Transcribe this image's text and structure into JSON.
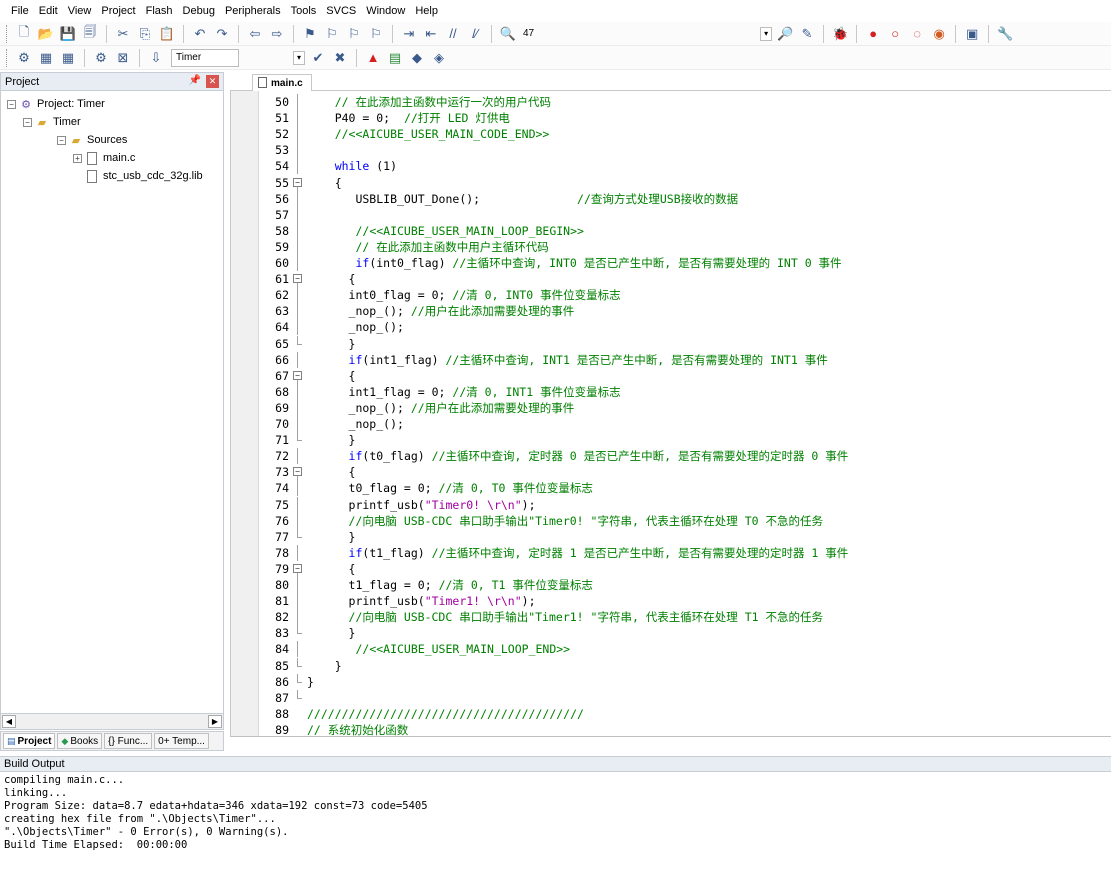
{
  "menu": [
    "File",
    "Edit",
    "View",
    "Project",
    "Flash",
    "Debug",
    "Peripherals",
    "Tools",
    "SVCS",
    "Window",
    "Help"
  ],
  "toolbar1": {
    "icons_left": [
      "new-file-icon",
      "open-folder-icon",
      "save-icon",
      "save-all-icon",
      "cut-icon",
      "copy-icon",
      "paste-icon",
      "undo-icon",
      "redo-icon",
      "nav-back-icon",
      "nav-forward-icon",
      "bookmark-icon",
      "bookmark-prev-icon",
      "bookmark-next-icon",
      "bookmark-clear-icon",
      "indent-icon",
      "unindent-icon",
      "comment-icon",
      "uncomment-icon",
      "find-in-files-icon"
    ],
    "find_value": "47",
    "icons_right": [
      "find-icon",
      "incremental-find-icon",
      "debug-session-icon",
      "breakpoint-icon",
      "breakpoint-disable-icon",
      "breakpoint-clear-icon",
      "breakpoint-kill-icon",
      "window-layout-icon",
      "configure-icon"
    ]
  },
  "toolbar2": {
    "icons_left": [
      "translate-icon",
      "build-icon",
      "rebuild-icon",
      "batch-build-icon",
      "stop-build-icon",
      "download-icon"
    ],
    "target_value": "Timer",
    "icons_right": [
      "target-options-icon",
      "file-extensions-icon",
      "manage-rte-icon",
      "select-packs-icon",
      "pack-installer-icon",
      "project-icon"
    ]
  },
  "project_panel": {
    "title": "Project",
    "tree": {
      "root": "Project: Timer",
      "target": "Timer",
      "group": "Sources",
      "files": [
        "main.c",
        "stc_usb_cdc_32g.lib"
      ]
    },
    "tabs": [
      "Project",
      "Books",
      "{} Func...",
      "0+ Temp..."
    ]
  },
  "editor": {
    "active_tab": "main.c",
    "lines": [
      {
        "n": "50",
        "fold": "line",
        "segs": [
          {
            "t": "    ",
            "c": ""
          },
          {
            "t": "// 在此添加主函数中运行一次的用户代码",
            "c": "c-comment"
          }
        ]
      },
      {
        "n": "51",
        "fold": "line",
        "segs": [
          {
            "t": "    P40 = 0;  ",
            "c": ""
          },
          {
            "t": "//打开 LED 灯供电",
            "c": "c-comment"
          }
        ]
      },
      {
        "n": "52",
        "fold": "line",
        "segs": [
          {
            "t": "    ",
            "c": ""
          },
          {
            "t": "//<<AICUBE_USER_MAIN_CODE_END>>",
            "c": "c-comment"
          }
        ]
      },
      {
        "n": "53",
        "fold": "line",
        "segs": []
      },
      {
        "n": "54",
        "fold": "line",
        "segs": [
          {
            "t": "    ",
            "c": ""
          },
          {
            "t": "while",
            "c": "c-kw"
          },
          {
            "t": " (1)",
            "c": ""
          }
        ]
      },
      {
        "n": "55",
        "fold": "box",
        "segs": [
          {
            "t": "    {",
            "c": ""
          }
        ]
      },
      {
        "n": "56",
        "fold": "line",
        "segs": [
          {
            "t": "       USBLIB_OUT_Done();              ",
            "c": ""
          },
          {
            "t": "//查询方式处理USB接收的数据",
            "c": "c-comment"
          }
        ]
      },
      {
        "n": "57",
        "fold": "line",
        "segs": []
      },
      {
        "n": "58",
        "fold": "line",
        "segs": [
          {
            "t": "       ",
            "c": ""
          },
          {
            "t": "//<<AICUBE_USER_MAIN_LOOP_BEGIN>>",
            "c": "c-comment"
          }
        ]
      },
      {
        "n": "59",
        "fold": "line",
        "segs": [
          {
            "t": "       ",
            "c": ""
          },
          {
            "t": "// 在此添加主函数中用户主循环代码",
            "c": "c-comment"
          }
        ]
      },
      {
        "n": "60",
        "fold": "line",
        "segs": [
          {
            "t": "       ",
            "c": ""
          },
          {
            "t": "if",
            "c": "c-kw"
          },
          {
            "t": "(int0_flag) ",
            "c": ""
          },
          {
            "t": "//主循环中查询, INT0 是否已产生中断, 是否有需要处理的 INT 0 事件",
            "c": "c-comment"
          }
        ]
      },
      {
        "n": "61",
        "fold": "box",
        "segs": [
          {
            "t": "      {",
            "c": ""
          }
        ]
      },
      {
        "n": "62",
        "fold": "line",
        "segs": [
          {
            "t": "      int0_flag = 0; ",
            "c": ""
          },
          {
            "t": "//清 0, INT0 事件位变量标志",
            "c": "c-comment"
          }
        ]
      },
      {
        "n": "63",
        "fold": "line",
        "segs": [
          {
            "t": "      _nop_(); ",
            "c": ""
          },
          {
            "t": "//用户在此添加需要处理的事件",
            "c": "c-comment"
          }
        ]
      },
      {
        "n": "64",
        "fold": "line",
        "segs": [
          {
            "t": "      _nop_();",
            "c": ""
          }
        ]
      },
      {
        "n": "65",
        "fold": "end",
        "segs": [
          {
            "t": "      }",
            "c": ""
          }
        ]
      },
      {
        "n": "66",
        "fold": "line",
        "segs": [
          {
            "t": "      ",
            "c": ""
          },
          {
            "t": "if",
            "c": "c-kw"
          },
          {
            "t": "(int1_flag) ",
            "c": ""
          },
          {
            "t": "//主循环中查询, INT1 是否已产生中断, 是否有需要处理的 INT1 事件",
            "c": "c-comment"
          }
        ]
      },
      {
        "n": "67",
        "fold": "box",
        "segs": [
          {
            "t": "      {",
            "c": ""
          }
        ]
      },
      {
        "n": "68",
        "fold": "line",
        "segs": [
          {
            "t": "      int1_flag = 0; ",
            "c": ""
          },
          {
            "t": "//清 0, INT1 事件位变量标志",
            "c": "c-comment"
          }
        ]
      },
      {
        "n": "69",
        "fold": "line",
        "segs": [
          {
            "t": "      _nop_(); ",
            "c": ""
          },
          {
            "t": "//用户在此添加需要处理的事件",
            "c": "c-comment"
          }
        ]
      },
      {
        "n": "70",
        "fold": "line",
        "segs": [
          {
            "t": "      _nop_();",
            "c": ""
          }
        ]
      },
      {
        "n": "71",
        "fold": "end",
        "segs": [
          {
            "t": "      }",
            "c": ""
          }
        ]
      },
      {
        "n": "72",
        "fold": "line",
        "segs": [
          {
            "t": "      ",
            "c": ""
          },
          {
            "t": "if",
            "c": "c-kw"
          },
          {
            "t": "(t0_flag) ",
            "c": ""
          },
          {
            "t": "//主循环中查询, 定时器 0 是否已产生中断, 是否有需要处理的定时器 0 事件",
            "c": "c-comment"
          }
        ]
      },
      {
        "n": "73",
        "fold": "box",
        "segs": [
          {
            "t": "      {",
            "c": ""
          }
        ]
      },
      {
        "n": "74",
        "fold": "line",
        "segs": [
          {
            "t": "      t0_flag = 0; ",
            "c": ""
          },
          {
            "t": "//清 0, T0 事件位变量标志",
            "c": "c-comment"
          }
        ]
      },
      {
        "n": "75",
        "fold": "line",
        "segs": [
          {
            "t": "      printf_usb(",
            "c": ""
          },
          {
            "t": "\"Timer0! \\r\\n\"",
            "c": "c-str"
          },
          {
            "t": ");",
            "c": ""
          }
        ]
      },
      {
        "n": "76",
        "fold": "line",
        "segs": [
          {
            "t": "      ",
            "c": ""
          },
          {
            "t": "//向电脑 USB-CDC 串口助手输出\"Timer0! \"字符串, 代表主循环在处理 T0 不急的任务",
            "c": "c-comment"
          }
        ]
      },
      {
        "n": "77",
        "fold": "end",
        "segs": [
          {
            "t": "      }",
            "c": ""
          }
        ]
      },
      {
        "n": "78",
        "fold": "line",
        "segs": [
          {
            "t": "      ",
            "c": ""
          },
          {
            "t": "if",
            "c": "c-kw"
          },
          {
            "t": "(t1_flag) ",
            "c": ""
          },
          {
            "t": "//主循环中查询, 定时器 1 是否已产生中断, 是否有需要处理的定时器 1 事件",
            "c": "c-comment"
          }
        ]
      },
      {
        "n": "79",
        "fold": "box",
        "segs": [
          {
            "t": "      {",
            "c": ""
          }
        ]
      },
      {
        "n": "80",
        "fold": "line",
        "segs": [
          {
            "t": "      t1_flag = 0; ",
            "c": ""
          },
          {
            "t": "//清 0, T1 事件位变量标志",
            "c": "c-comment"
          }
        ]
      },
      {
        "n": "81",
        "fold": "line",
        "segs": [
          {
            "t": "      printf_usb(",
            "c": ""
          },
          {
            "t": "\"Timer1! \\r\\n\"",
            "c": "c-str"
          },
          {
            "t": ");",
            "c": ""
          }
        ]
      },
      {
        "n": "82",
        "fold": "line",
        "segs": [
          {
            "t": "      ",
            "c": ""
          },
          {
            "t": "//向电脑 USB-CDC 串口助手输出\"Timer1! \"字符串, 代表主循环在处理 T1 不急的任务",
            "c": "c-comment"
          }
        ]
      },
      {
        "n": "83",
        "fold": "end",
        "segs": [
          {
            "t": "      }",
            "c": ""
          }
        ]
      },
      {
        "n": "84",
        "fold": "line",
        "segs": [
          {
            "t": "       ",
            "c": ""
          },
          {
            "t": "//<<AICUBE_USER_MAIN_LOOP_END>>",
            "c": "c-comment"
          }
        ]
      },
      {
        "n": "85",
        "fold": "end",
        "segs": [
          {
            "t": "    }",
            "c": ""
          }
        ]
      },
      {
        "n": "86",
        "fold": "end",
        "segs": [
          {
            "t": "}",
            "c": ""
          }
        ]
      },
      {
        "n": "87",
        "fold": "end",
        "segs": []
      },
      {
        "n": "88",
        "fold": "none",
        "segs": [
          {
            "t": "////////////////////////////////////////",
            "c": "c-comment"
          }
        ]
      },
      {
        "n": "89",
        "fold": "none",
        "segs": [
          {
            "t": "// 系统初始化函数",
            "c": "c-comment"
          }
        ]
      }
    ]
  },
  "build_output": {
    "title": "Build Output",
    "lines": [
      "compiling main.c...",
      "linking...",
      "Program Size: data=8.7 edata+hdata=346 xdata=192 const=73 code=5405",
      "creating hex file from \".\\Objects\\Timer\"...",
      "\".\\Objects\\Timer\" - 0 Error(s), 0 Warning(s).",
      "Build Time Elapsed:  00:00:00"
    ]
  }
}
